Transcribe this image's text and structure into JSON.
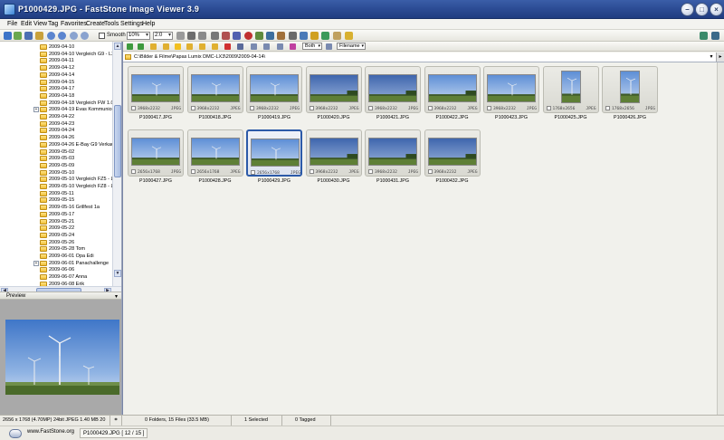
{
  "window": {
    "title": "P1000429.JPG - FastStone Image Viewer 3.9"
  },
  "menu": [
    "File",
    "Edit",
    "View",
    "Tag",
    "Favorites",
    "Create",
    "Tools",
    "Settings",
    "Help"
  ],
  "toolbar": {
    "smooth_label": "Smooth",
    "zoom_value": "10%",
    "ratio_value": "2:0"
  },
  "toolbar2": {
    "filter_value": "Both",
    "sort_value": "Filename"
  },
  "tree": [
    {
      "label": "2009-04-10"
    },
    {
      "label": "2009-04-10 Vergleich G9 - LX3"
    },
    {
      "label": "2009-04-11"
    },
    {
      "label": "2009-04-12"
    },
    {
      "label": "2009-04-14"
    },
    {
      "label": "2009-04-15"
    },
    {
      "label": "2009-04-17"
    },
    {
      "label": "2009-04-18"
    },
    {
      "label": "2009-04-18 Vergleich FW 1.0-"
    },
    {
      "label": "2009-04-19 Evas Kommunion",
      "expandable": true
    },
    {
      "label": "2009-04-22"
    },
    {
      "label": "2009-04-23"
    },
    {
      "label": "2009-04-24"
    },
    {
      "label": "2009-04-26"
    },
    {
      "label": "2009-04-26 E-Bay G9 Verkauf"
    },
    {
      "label": "2009-05-02"
    },
    {
      "label": "2009-05-03"
    },
    {
      "label": "2009-05-09"
    },
    {
      "label": "2009-05-10"
    },
    {
      "label": "2009-05-10 Vergleich FZ5 - LX"
    },
    {
      "label": "2009-05-10 Vergleich FZ8 - LX"
    },
    {
      "label": "2009-05-11"
    },
    {
      "label": "2009-05-15"
    },
    {
      "label": "2009-05-16 Grillfest 1a"
    },
    {
      "label": "2009-05-17"
    },
    {
      "label": "2009-05-21"
    },
    {
      "label": "2009-05-22"
    },
    {
      "label": "2009-05-24"
    },
    {
      "label": "2009-05-26"
    },
    {
      "label": "2009-05-28 Tom"
    },
    {
      "label": "2009-06-01 Opa Edi"
    },
    {
      "label": "2009-06-01 Panachallenge",
      "expandable": true
    },
    {
      "label": "2009-06-06"
    },
    {
      "label": "2009-06-07 Anna"
    },
    {
      "label": "2009-06-08 Erik"
    }
  ],
  "preview": {
    "header": "Preview"
  },
  "path": "C:\\Bilder & Filme\\Papas Lumix DMC-LX3\\2009\\2009-04-14\\",
  "thumbnails": [
    {
      "name": "P1000417.JPG",
      "dims": "3968x2232",
      "fmt": "JPEG"
    },
    {
      "name": "P1000418.JPG",
      "dims": "3968x2232",
      "fmt": "JPEG"
    },
    {
      "name": "P1000419.JPG",
      "dims": "3968x2232",
      "fmt": "JPEG"
    },
    {
      "name": "P1000420.JPG",
      "dims": "3968x2232",
      "fmt": "JPEG"
    },
    {
      "name": "P1000421.JPG",
      "dims": "3968x2232",
      "fmt": "JPEG"
    },
    {
      "name": "P1000422.JPG",
      "dims": "3968x2232",
      "fmt": "JPEG"
    },
    {
      "name": "P1000423.JPG",
      "dims": "3968x2232",
      "fmt": "JPEG"
    },
    {
      "name": "P1000425.JPG",
      "dims": "1768x2656",
      "fmt": "JPEG"
    },
    {
      "name": "P1000426.JPG",
      "dims": "1768x2656",
      "fmt": "JPEG"
    },
    {
      "name": "P1000427.JPG",
      "dims": "2656x1768",
      "fmt": "JPEG"
    },
    {
      "name": "P1000428.JPG",
      "dims": "2656x1768",
      "fmt": "JPEG"
    },
    {
      "name": "P1000429.JPG",
      "dims": "2656x1768",
      "fmt": "JPEG"
    },
    {
      "name": "P1000430.JPG",
      "dims": "3968x2232",
      "fmt": "JPEG"
    },
    {
      "name": "P1000431.JPG",
      "dims": "3968x2232",
      "fmt": "JPEG"
    },
    {
      "name": "P1000432.JPG",
      "dims": "3968x2232",
      "fmt": "JPEG"
    }
  ],
  "status": {
    "image_info": "2656 x 1768 (4.70MP)  24bit JPEG  1.40 MB  20",
    "folders_files": "0 Folders, 15 Files (33.5 MB)",
    "selected": "1 Selected",
    "tagged": "0 Tagged"
  },
  "bottom": {
    "site": "www.FastStone.org",
    "file_info": "P1000429.JPG [ 12 / 15 ]"
  },
  "colors": {
    "titlebar": "#2d4d96",
    "selection": "#2c5aa8"
  }
}
